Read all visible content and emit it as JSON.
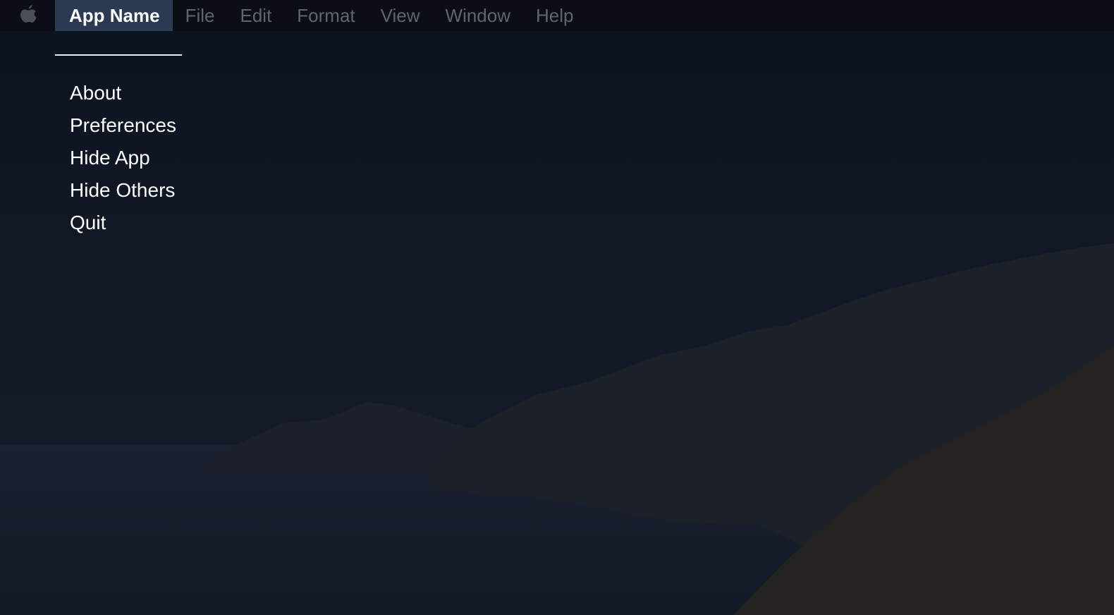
{
  "menubar": {
    "apple_icon": "apple-logo-icon",
    "items": [
      {
        "label": "App Name",
        "active": true
      },
      {
        "label": "File"
      },
      {
        "label": "Edit"
      },
      {
        "label": "Format"
      },
      {
        "label": "View"
      },
      {
        "label": "Window"
      },
      {
        "label": "Help"
      }
    ]
  },
  "app_menu": {
    "items": [
      {
        "label": "About"
      },
      {
        "label": "Preferences"
      },
      {
        "label": "Hide App"
      },
      {
        "label": "Hide Others"
      },
      {
        "label": "Quit"
      }
    ]
  },
  "colors": {
    "menubar_bg": "#0b0e14",
    "active_item_bg": "#2b3a52",
    "inactive_text": "#5f6470",
    "desktop_sky": "#101826"
  }
}
